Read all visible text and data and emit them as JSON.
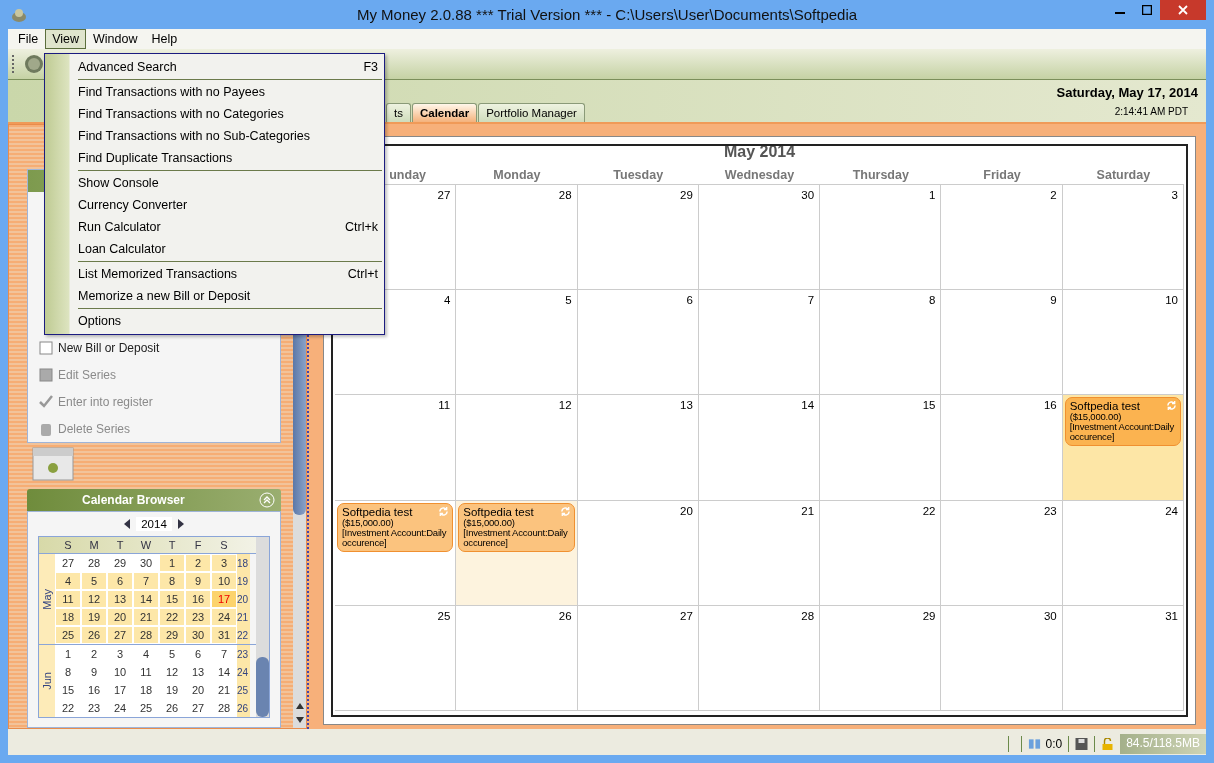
{
  "window": {
    "title": "My Money 2.0.88 *** Trial Version *** - C:\\Users\\User\\Documents\\Softpedia"
  },
  "menu_bar": [
    {
      "label": "File",
      "selected": false
    },
    {
      "label": "View",
      "selected": true
    },
    {
      "label": "Window",
      "selected": false
    },
    {
      "label": "Help",
      "selected": false
    }
  ],
  "view_menu": [
    {
      "kind": "item",
      "label": "Advanced Search",
      "shortcut": "F3"
    },
    {
      "kind": "separator"
    },
    {
      "kind": "item",
      "label": "Find Transactions with no Payees"
    },
    {
      "kind": "item",
      "label": "Find Transactions with no Categories"
    },
    {
      "kind": "item",
      "label": "Find Transactions with no Sub-Categories"
    },
    {
      "kind": "item",
      "label": "Find Duplicate Transactions"
    },
    {
      "kind": "separator"
    },
    {
      "kind": "item",
      "label": "Show Console"
    },
    {
      "kind": "item",
      "label": "Currency Converter"
    },
    {
      "kind": "item",
      "label": "Run Calculator",
      "shortcut": "Ctrl+k"
    },
    {
      "kind": "item",
      "label": "Loan Calculator"
    },
    {
      "kind": "separator"
    },
    {
      "kind": "item",
      "label": "List Memorized Transactions",
      "shortcut": "Ctrl+t"
    },
    {
      "kind": "item",
      "label": "Memorize a new Bill or Deposit"
    },
    {
      "kind": "separator"
    },
    {
      "kind": "item",
      "label": "Options"
    }
  ],
  "tabs": [
    {
      "label": "ts",
      "selected": false
    },
    {
      "label": "Calendar",
      "selected": true
    },
    {
      "label": "Portfolio Manager",
      "selected": false
    }
  ],
  "clock": {
    "date": "Saturday, May 17, 2014",
    "time": "2:14:41 AM PDT"
  },
  "actions": [
    {
      "label": "New Bill or Deposit",
      "disabled": false
    },
    {
      "label": "Edit Series",
      "disabled": true
    },
    {
      "label": "Enter into register",
      "disabled": true
    },
    {
      "label": "Delete Series",
      "disabled": true
    }
  ],
  "calendar_browser": {
    "title": "Calendar Browser",
    "year": "2014",
    "weekdays": [
      "S",
      "M",
      "T",
      "W",
      "T",
      "F",
      "S"
    ],
    "months": [
      {
        "label": "May",
        "weeks": [
          {
            "week": "18",
            "days": [
              {
                "day": "27",
                "in_month": false,
                "selected": false
              },
              {
                "day": "28",
                "in_month": false,
                "selected": false
              },
              {
                "day": "29",
                "in_month": false,
                "selected": false
              },
              {
                "day": "30",
                "in_month": false,
                "selected": false
              },
              {
                "day": "1",
                "in_month": true,
                "selected": false
              },
              {
                "day": "2",
                "in_month": true,
                "selected": false
              },
              {
                "day": "3",
                "in_month": true,
                "selected": false
              }
            ]
          },
          {
            "week": "19",
            "days": [
              {
                "day": "4",
                "in_month": true,
                "selected": false
              },
              {
                "day": "5",
                "in_month": true,
                "selected": false
              },
              {
                "day": "6",
                "in_month": true,
                "selected": false
              },
              {
                "day": "7",
                "in_month": true,
                "selected": false
              },
              {
                "day": "8",
                "in_month": true,
                "selected": false
              },
              {
                "day": "9",
                "in_month": true,
                "selected": false
              },
              {
                "day": "10",
                "in_month": true,
                "selected": false
              }
            ]
          },
          {
            "week": "20",
            "days": [
              {
                "day": "11",
                "in_month": true,
                "selected": false
              },
              {
                "day": "12",
                "in_month": true,
                "selected": false
              },
              {
                "day": "13",
                "in_month": true,
                "selected": false
              },
              {
                "day": "14",
                "in_month": true,
                "selected": false
              },
              {
                "day": "15",
                "in_month": true,
                "selected": false
              },
              {
                "day": "16",
                "in_month": true,
                "selected": false
              },
              {
                "day": "17",
                "in_month": true,
                "selected": true
              }
            ]
          },
          {
            "week": "21",
            "days": [
              {
                "day": "18",
                "in_month": true,
                "selected": false
              },
              {
                "day": "19",
                "in_month": true,
                "selected": false
              },
              {
                "day": "20",
                "in_month": true,
                "selected": false
              },
              {
                "day": "21",
                "in_month": true,
                "selected": false
              },
              {
                "day": "22",
                "in_month": true,
                "selected": false
              },
              {
                "day": "23",
                "in_month": true,
                "selected": false
              },
              {
                "day": "24",
                "in_month": true,
                "selected": false
              }
            ]
          },
          {
            "week": "22",
            "days": [
              {
                "day": "25",
                "in_month": true,
                "selected": false
              },
              {
                "day": "26",
                "in_month": true,
                "selected": false
              },
              {
                "day": "27",
                "in_month": true,
                "selected": false
              },
              {
                "day": "28",
                "in_month": true,
                "selected": false
              },
              {
                "day": "29",
                "in_month": true,
                "selected": false
              },
              {
                "day": "30",
                "in_month": true,
                "selected": false
              },
              {
                "day": "31",
                "in_month": true,
                "selected": false
              }
            ]
          }
        ]
      },
      {
        "label": "Jun",
        "weeks": [
          {
            "week": "23",
            "days": [
              {
                "day": "1",
                "in_month": false,
                "selected": false
              },
              {
                "day": "2",
                "in_month": false,
                "selected": false
              },
              {
                "day": "3",
                "in_month": false,
                "selected": false
              },
              {
                "day": "4",
                "in_month": false,
                "selected": false
              },
              {
                "day": "5",
                "in_month": false,
                "selected": false
              },
              {
                "day": "6",
                "in_month": false,
                "selected": false
              },
              {
                "day": "7",
                "in_month": false,
                "selected": false
              }
            ]
          },
          {
            "week": "24",
            "days": [
              {
                "day": "8",
                "in_month": false,
                "selected": false
              },
              {
                "day": "9",
                "in_month": false,
                "selected": false
              },
              {
                "day": "10",
                "in_month": false,
                "selected": false
              },
              {
                "day": "11",
                "in_month": false,
                "selected": false
              },
              {
                "day": "12",
                "in_month": false,
                "selected": false
              },
              {
                "day": "13",
                "in_month": false,
                "selected": false
              },
              {
                "day": "14",
                "in_month": false,
                "selected": false
              }
            ]
          },
          {
            "week": "25",
            "days": [
              {
                "day": "15",
                "in_month": false,
                "selected": false
              },
              {
                "day": "16",
                "in_month": false,
                "selected": false
              },
              {
                "day": "17",
                "in_month": false,
                "selected": false
              },
              {
                "day": "18",
                "in_month": false,
                "selected": false
              },
              {
                "day": "19",
                "in_month": false,
                "selected": false
              },
              {
                "day": "20",
                "in_month": false,
                "selected": false
              },
              {
                "day": "21",
                "in_month": false,
                "selected": false
              }
            ]
          },
          {
            "week": "26",
            "days": [
              {
                "day": "22",
                "in_month": false,
                "selected": false
              },
              {
                "day": "23",
                "in_month": false,
                "selected": false
              },
              {
                "day": "24",
                "in_month": false,
                "selected": false
              },
              {
                "day": "25",
                "in_month": false,
                "selected": false
              },
              {
                "day": "26",
                "in_month": false,
                "selected": false
              },
              {
                "day": "27",
                "in_month": false,
                "selected": false
              },
              {
                "day": "28",
                "in_month": false,
                "selected": false
              }
            ]
          }
        ]
      }
    ]
  },
  "month_view": {
    "title": "May 2014",
    "weekdays": [
      "unday",
      "Monday",
      "Tuesday",
      "Wednesday",
      "Thursday",
      "Friday",
      "Saturday"
    ],
    "weeks": [
      [
        {
          "day": "27",
          "selected": false,
          "highlighted": false
        },
        {
          "day": "28",
          "selected": false,
          "highlighted": false
        },
        {
          "day": "29",
          "selected": false,
          "highlighted": false
        },
        {
          "day": "30",
          "selected": false,
          "highlighted": false
        },
        {
          "day": "1",
          "selected": false,
          "highlighted": false
        },
        {
          "day": "2",
          "selected": false,
          "highlighted": false
        },
        {
          "day": "3",
          "selected": false,
          "highlighted": false
        }
      ],
      [
        {
          "day": "4",
          "selected": false,
          "highlighted": false
        },
        {
          "day": "5",
          "selected": false,
          "highlighted": false
        },
        {
          "day": "6",
          "selected": false,
          "highlighted": false
        },
        {
          "day": "7",
          "selected": false,
          "highlighted": false
        },
        {
          "day": "8",
          "selected": false,
          "highlighted": false
        },
        {
          "day": "9",
          "selected": false,
          "highlighted": false
        },
        {
          "day": "10",
          "selected": false,
          "highlighted": false
        }
      ],
      [
        {
          "day": "11",
          "selected": false,
          "highlighted": false
        },
        {
          "day": "12",
          "selected": false,
          "highlighted": false
        },
        {
          "day": "13",
          "selected": false,
          "highlighted": false
        },
        {
          "day": "14",
          "selected": false,
          "highlighted": false
        },
        {
          "day": "15",
          "selected": false,
          "highlighted": false
        },
        {
          "day": "16",
          "selected": false,
          "highlighted": false
        },
        {
          "selected": true,
          "highlighted": false,
          "event": {
            "title": "Softpedia test",
            "amount": "($15,000.00)",
            "account": "[Investment Account:Daily occurence]"
          }
        }
      ],
      [
        {
          "selected": false,
          "highlighted": false,
          "event": {
            "title": "Softpedia test",
            "amount": "($15,000.00)",
            "account": "[Investment Account:Daily occurence]"
          }
        },
        {
          "selected": false,
          "highlighted": true,
          "event": {
            "title": "Softpedia test",
            "amount": "($15,000.00)",
            "account": "[Investment Account:Daily occurence]"
          }
        },
        {
          "day": "20",
          "selected": false,
          "highlighted": false
        },
        {
          "day": "21",
          "selected": false,
          "highlighted": false
        },
        {
          "day": "22",
          "selected": false,
          "highlighted": false
        },
        {
          "day": "23",
          "selected": false,
          "highlighted": false
        },
        {
          "day": "24",
          "selected": false,
          "highlighted": false
        }
      ],
      [
        {
          "day": "25",
          "selected": false,
          "highlighted": false
        },
        {
          "day": "26",
          "selected": false,
          "highlighted": false
        },
        {
          "day": "27",
          "selected": false,
          "highlighted": false
        },
        {
          "day": "28",
          "selected": false,
          "highlighted": false
        },
        {
          "day": "29",
          "selected": false,
          "highlighted": false
        },
        {
          "day": "30",
          "selected": false,
          "highlighted": false
        },
        {
          "day": "31",
          "selected": false,
          "highlighted": false
        }
      ]
    ]
  },
  "status_bar": {
    "count": "0:0",
    "memory": "84.5/118.5MB"
  }
}
